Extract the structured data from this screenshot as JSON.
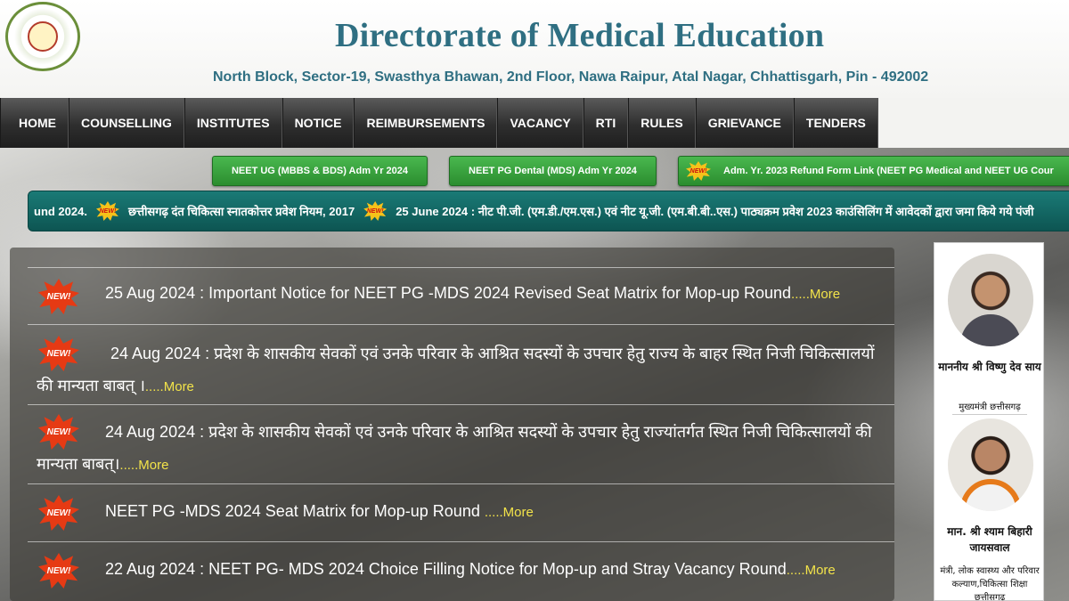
{
  "header": {
    "title": "Directorate of Medical Education",
    "address": "North Block, Sector-19, Swasthya Bhawan, 2nd Floor, Nawa Raipur, Atal Nagar, Chhattisgarh, Pin - 492002",
    "emblem_icon": "chhattisgarh-govt-emblem-icon"
  },
  "nav": {
    "items": [
      "HOME",
      "COUNSELLING",
      "INSTITUTES",
      "NOTICE",
      "REIMBURSEMENTS",
      "VACANCY",
      "RTI",
      "RULES",
      "GRIEVANCE",
      "TENDERS"
    ]
  },
  "quick_links": [
    "NEET UG (MBBS & BDS) Adm Yr 2024",
    "NEET PG Dental (MDS) Adm Yr 2024",
    "Adm. Yr. 2023 Refund Form Link (NEET PG Medical and NEET UG Cour"
  ],
  "ticker": {
    "items": [
      "und 2024.",
      "छत्तीसगढ़ दंत चिकित्सा स्नातकोत्तर प्रवेश नियम, 2017",
      "25 June 2024 : नीट पी.जी. (एम.डी./एम.एस.) एवं नीट यू.जी. (एम.बी.बी..एस.) पाठ्यक्रम प्रवेश 2023 काउंसिलिंग में आवेदकों द्वारा जमा किये गये पंजी"
    ]
  },
  "badge_text": "NEW!",
  "notices": [
    {
      "text": "25 Aug 2024 : Important Notice for NEET PG -MDS 2024 Revised Seat Matrix for Mop-up Round",
      "more": ".....More"
    },
    {
      "text": "24 Aug 2024 : प्रदेश के शासकीय सेवकों एवं उनके परिवार के आश्रित सदस्यों के उपचार हेतु राज्य के बाहर स्थित निजी चिकित्सालयों की मान्यता बाबत् ।",
      "more": ".....More"
    },
    {
      "text": "24 Aug 2024 : प्रदेश के शासकीय सेवकों एवं उनके परिवार के आश्रित सदस्यों के उपचार हेतु राज्यांतर्गत स्थित निजी चिकित्सालयों की मान्यता बाबत्।",
      "more": ".....More"
    },
    {
      "text": "NEET PG -MDS 2024 Seat Matrix for Mop-up Round ",
      "more": ".....More"
    },
    {
      "text": "22 Aug 2024 : NEET PG- MDS 2024 Choice Filling Notice for Mop-up and Stray Vacancy Round",
      "more": ".....More"
    }
  ],
  "sidebar": {
    "person1_name": "माननीय श्री विष्णु देव साय",
    "person1_title": "मुख्यमंत्री छत्तीसगढ़",
    "person2_name": "मान. श्री श्याम बिहारी जायसवाल",
    "person2_title": "मंत्री, लोक स्वास्थ्य और परिवार कल्याण,चिकित्सा शिक्षा छत्तीसगढ़"
  },
  "colors": {
    "title": "#2f6f82",
    "nav_bg": "#2e2e2e",
    "quick_link_green": "#2b8d2f",
    "ticker_teal": "#0d5552",
    "more_link": "#f2e34a",
    "new_badge": "#e63a14"
  }
}
